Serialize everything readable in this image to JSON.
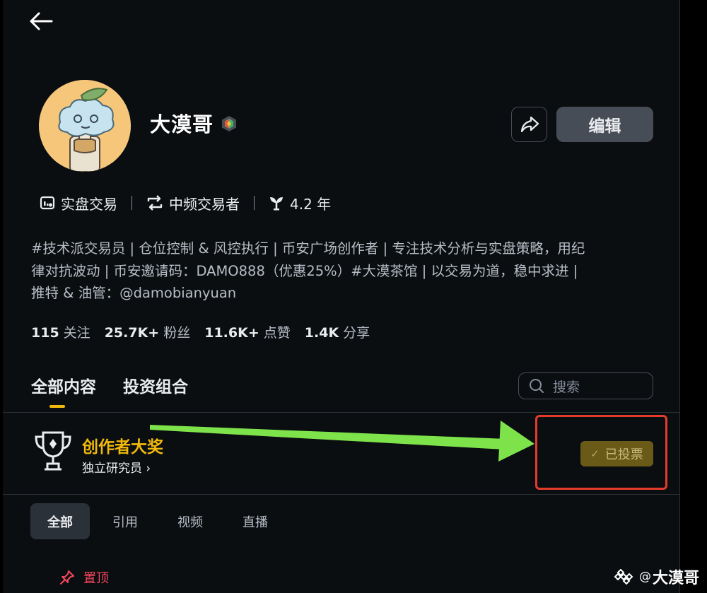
{
  "profile": {
    "name": "大漠哥",
    "tags": [
      {
        "icon": "live-trading-icon",
        "label": "实盘交易"
      },
      {
        "icon": "swap-frequency-icon",
        "label": "中频交易者"
      },
      {
        "icon": "sprout-icon",
        "label": "4.2 年"
      }
    ],
    "bio_lines": [
      "#技术派交易员 | 仓位控制 & 风控执行 | 币安广场创作者 | 专注技术分析与实盘策略，用纪",
      "律对抗波动 | 币安邀请码：DAMO888（优惠25%）#大漠茶馆 | 以交易为道，稳中求进 |",
      "推特 & 油管：@damobianyuan"
    ],
    "stats": [
      {
        "value": "115",
        "label": "关注"
      },
      {
        "value": "25.7K+",
        "label": "粉丝"
      },
      {
        "value": "11.6K+",
        "label": "点赞"
      },
      {
        "value": "1.4K",
        "label": "分享"
      }
    ]
  },
  "header": {
    "edit_label": "编辑"
  },
  "tabs": [
    {
      "label": "全部内容",
      "active": true
    },
    {
      "label": "投资组合",
      "active": false
    }
  ],
  "search": {
    "placeholder": "搜索"
  },
  "award": {
    "title": "创作者大奖",
    "subtitle": "独立研究员",
    "chevron": "›",
    "button_check": "✓",
    "button_label": "已投票"
  },
  "filters": [
    {
      "label": "全部",
      "active": true
    },
    {
      "label": "引用",
      "active": false
    },
    {
      "label": "视频",
      "active": false
    },
    {
      "label": "直播",
      "active": false
    }
  ],
  "pinned": {
    "label": "置顶"
  },
  "watermark": {
    "at": "@",
    "name": "大漠哥"
  },
  "colors": {
    "accent": "#f0b90b",
    "background": "#0b0e11",
    "annotation_arrow": "#7ee24a",
    "annotation_box": "#e53b2c",
    "pin": "#f6465d"
  }
}
